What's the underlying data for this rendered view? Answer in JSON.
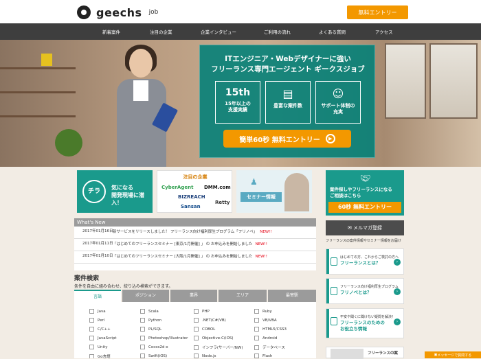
{
  "header": {
    "logo_name": "geechs",
    "logo_sub": "job",
    "entry_button": "無料エントリー"
  },
  "nav": {
    "items": [
      "新着案件",
      "注目の企業",
      "企業インタビュー",
      "ご利用の流れ",
      "よくある質問",
      "アクセス"
    ]
  },
  "hero": {
    "line1": "ITエンジニア・Webデザイナーに強い",
    "line2": "フリーランス専門エージェント ギークスジョブ",
    "features": [
      {
        "big": "15th",
        "text1": "15年以上の",
        "text2": "支援実績",
        "icon": "15th-badge"
      },
      {
        "big": "",
        "text1": "豊富な案件数",
        "text2": "",
        "icon": "document-stack-icon"
      },
      {
        "big": "",
        "text1": "サポート体制の",
        "text2": "充実",
        "icon": "support-person-icon"
      }
    ],
    "cta": "簡単60秒 無料エントリー"
  },
  "banners": {
    "b1_circle": "チラ",
    "b1_line1": "気になる",
    "b1_line2": "開発現場に潜入！",
    "b2_title": "注目の企業",
    "b2_logos": [
      "CyberAgent",
      "DMM.com",
      "BIZREACH",
      "Retty",
      "Sansan"
    ],
    "b3_text": "セミナー情報"
  },
  "side_cta": {
    "line1": "案件探しやフリーランスになる",
    "line2": "ご相談はこちら",
    "button": "60秒 無料エントリー"
  },
  "news": {
    "title": "What's New",
    "items": [
      {
        "date": "2017年01月16日",
        "text": "新サービスをリリースしました！ フリーランス向け福利厚生プログラム「フリノベ」",
        "new": "NEW!!"
      },
      {
        "date": "2017年01月11日",
        "text": "「はじめてのフリーランスセミナー [東京/1月開催] 」 の お申込みを開始しました",
        "new": "NEW!!"
      },
      {
        "date": "2017年01月10日",
        "text": "「はじめてのフリーランスセミナー [大阪/1月開催] 」 の お申込みを開始しました",
        "new": "NEW!!"
      }
    ]
  },
  "mail": {
    "label": "メルマガ登録",
    "note": "フリーランスの案件情報やセミナー情報をお届け"
  },
  "side_links": [
    {
      "small": "はじめての方、これからご検討の方へ",
      "bold": "フリーランスとは？",
      "extra": ""
    },
    {
      "small": "フリーランス向け福利厚生プログラム",
      "bold": "フリノベとは？",
      "extra": ""
    },
    {
      "small": "不安や聞くに聞けない疑問を解決！",
      "bold": "フリーランスのための",
      "extra": "お役立ち情報"
    }
  ],
  "search": {
    "title": "案件検索",
    "subtitle": "条件を自由に組み合わせ、絞り込み検索ができます。",
    "tabs": [
      "言語",
      "ポジション",
      "業界",
      "エリア",
      "最寄駅"
    ],
    "options": [
      [
        "Java",
        "Scala",
        "PHP",
        "Ruby"
      ],
      [
        "Perl",
        "Python",
        ".NET(C#/VB)",
        "VB/VBA"
      ],
      [
        "C/C++",
        "PL/SQL",
        "COBOL",
        "HTML5/CSS3"
      ],
      [
        "JavaScript",
        "Photoshop/Illustrator",
        "Objective-C(iOS)",
        "Android"
      ],
      [
        "Unity",
        "Cocos2d-x",
        "インフラ(サーバー/NW)",
        "データベース"
      ],
      [
        "Go言語",
        "Swift(iOS)",
        "Node.js",
        "Flash"
      ]
    ]
  },
  "bottom_card": {
    "title": "フリーランスの案"
  },
  "message_widget": {
    "label": "メッセージで質問する"
  }
}
